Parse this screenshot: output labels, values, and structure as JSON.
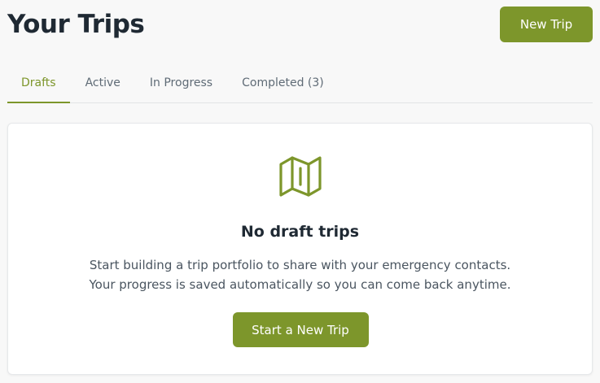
{
  "header": {
    "title": "Your Trips",
    "new_trip_label": "New Trip"
  },
  "tabs": [
    {
      "label": "Drafts",
      "active": true
    },
    {
      "label": "Active",
      "active": false
    },
    {
      "label": "In Progress",
      "active": false
    },
    {
      "label": "Completed (3)",
      "active": false
    }
  ],
  "empty_state": {
    "icon": "map-icon",
    "title": "No draft trips",
    "description_line1": "Start building a trip portfolio to share with your emergency contacts.",
    "description_line2": "Your progress is saved automatically so you can come back anytime.",
    "button_label": "Start a New Trip"
  },
  "colors": {
    "accent": "#7d962b",
    "background": "#f8f8f8",
    "card": "#ffffff",
    "text_dark": "#1f2933",
    "text_muted": "#5f6b76"
  }
}
